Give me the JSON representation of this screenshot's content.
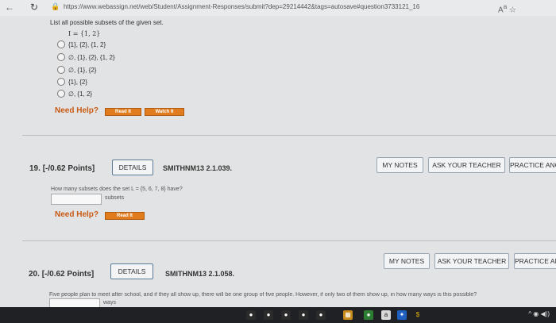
{
  "browser": {
    "url": "https://www.webassign.net/web/Student/Assignment-Responses/submit?dep=29214442&tags=autosave#question3733121_16",
    "back_icon": "back-arrow-icon",
    "reload_icon": "reload-icon"
  },
  "q18": {
    "prompt": "List all possible subsets of the given set.",
    "set_display": "I = {1, 2}",
    "options": [
      "{1}, {2}, {1, 2}",
      "∅, {1}, {2}, {1, 2}",
      "∅, {1}, {2}",
      "{1}, {2}",
      "∅, {1, 2}"
    ],
    "need_help": "Need Help?",
    "read_it": "Read It",
    "watch_it": "Watch It"
  },
  "q19": {
    "number": "19.",
    "points": "[-/0.62 Points]",
    "details": "DETAILS",
    "code": "SMITHNM13 2.1.039.",
    "my_notes": "MY NOTES",
    "ask_teacher": "ASK YOUR TEACHER",
    "practice": "PRACTICE ANOTHER",
    "question": "How many subsets does the set  L = {5, 6, 7, 8}  have?",
    "unit": "subsets",
    "need_help": "Need Help?",
    "read_it": "Read It"
  },
  "q20": {
    "number": "20.",
    "points": "[-/0.62 Points]",
    "details": "DETAILS",
    "code": "SMITHNM13 2.1.058.",
    "my_notes": "MY NOTES",
    "ask_teacher": "ASK YOUR TEACHER",
    "practice": "PRACTICE ANOTHER",
    "question": "Five people plan to meet after school, and if they all show up, there will be one group of five people. However, if only two of them show up, in how many ways is this possible?",
    "unit": "ways"
  }
}
